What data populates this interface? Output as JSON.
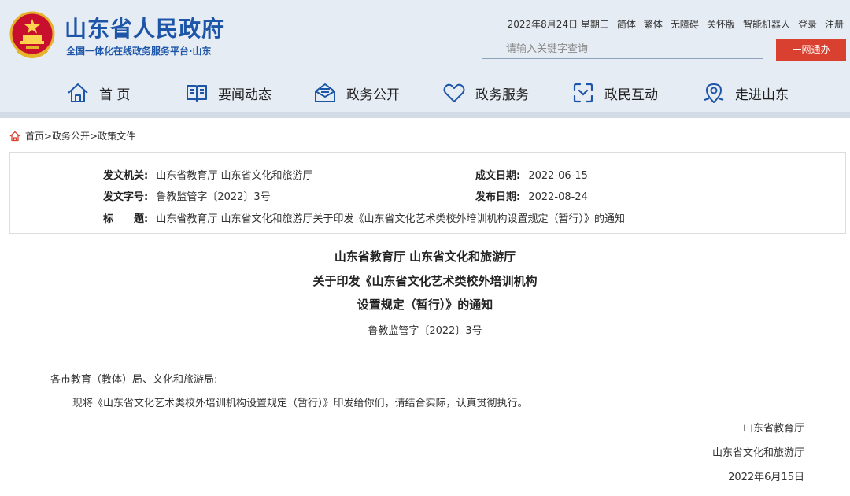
{
  "header": {
    "site_title": "山东省人民政府",
    "site_subtitle": "全国一体化在线政务服务平台·山东",
    "topbar": {
      "date": "2022年8月24日 星期三",
      "links": [
        "简体",
        "繁体",
        "无障碍",
        "关怀版",
        "智能机器人",
        "登录",
        "注册"
      ]
    },
    "search": {
      "placeholder": "请输入关键字查询",
      "button_label": "一网通办"
    },
    "nav": [
      {
        "label": "首 页",
        "icon": "home-icon"
      },
      {
        "label": "要闻动态",
        "icon": "book-icon"
      },
      {
        "label": "政务公开",
        "icon": "inbox-icon"
      },
      {
        "label": "政务服务",
        "icon": "heart-icon"
      },
      {
        "label": "政民互动",
        "icon": "interaction-icon"
      },
      {
        "label": "走进山东",
        "icon": "location-icon"
      }
    ]
  },
  "breadcrumb": "首页>政务公开>政策文件",
  "info": {
    "issuer_label": "发文机关:",
    "issuer": "山东省教育厅 山东省文化和旅游厅",
    "doc_no_label": "发文字号:",
    "doc_no": "鲁教监管字〔2022〕3号",
    "title_label": "标　　题:",
    "title": "山东省教育厅 山东省文化和旅游厅关于印发《山东省文化艺术类校外培训机构设置规定（暂行）》的通知",
    "written_label": "成文日期:",
    "written_date": "2022-06-15",
    "published_label": "发布日期:",
    "published_date": "2022-08-24"
  },
  "document": {
    "title_lines": [
      "山东省教育厅 山东省文化和旅游厅",
      "关于印发《山东省文化艺术类校外培训机构",
      "设置规定（暂行）》的通知"
    ],
    "number": "鲁教监管字〔2022〕3号",
    "salutation": "各市教育（教体）局、文化和旅游局:",
    "body": "现将《山东省文化艺术类校外培训机构设置规定（暂行）》印发给你们，请结合实际，认真贯彻执行。",
    "signatures": [
      "山东省教育厅",
      "山东省文化和旅游厅",
      "2022年6月15日"
    ]
  }
}
